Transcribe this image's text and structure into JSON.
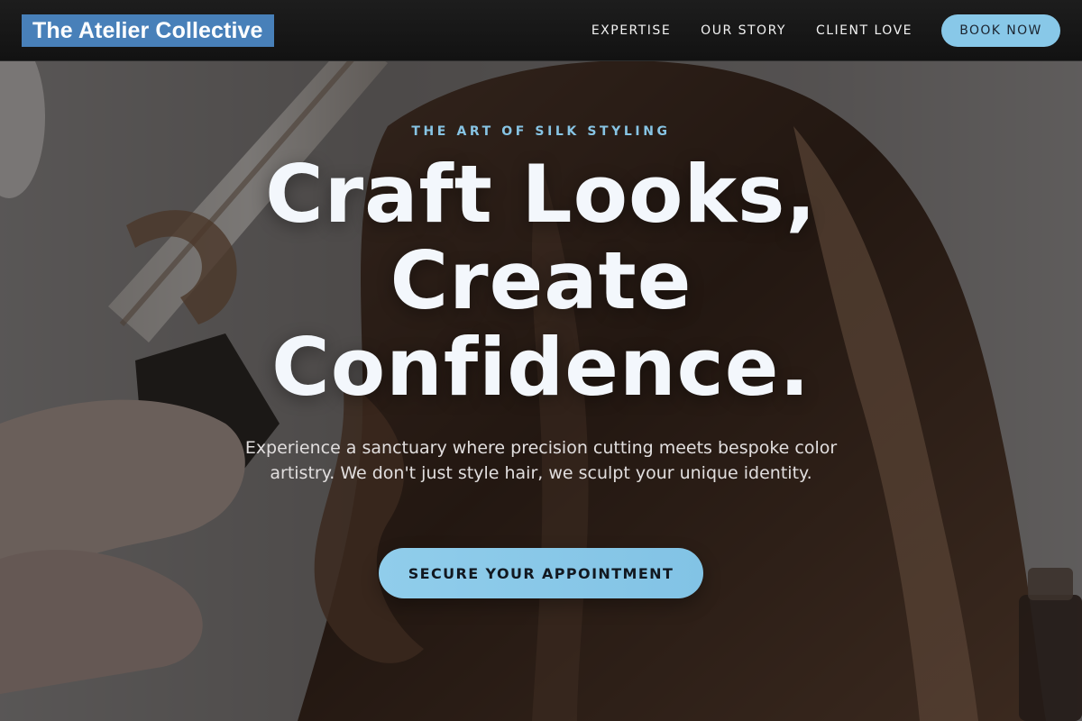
{
  "header": {
    "brand": "The Atelier Collective",
    "nav": [
      {
        "label": "EXPERTISE"
      },
      {
        "label": "OUR STORY"
      },
      {
        "label": "CLIENT LOVE"
      }
    ],
    "book_label": "BOOK NOW"
  },
  "hero": {
    "eyebrow": "THE ART OF SILK STYLING",
    "headline": "Craft Looks, Create Confidence.",
    "subtext": "Experience a sanctuary where precision cutting meets bespoke color artistry. We don't just style hair, we sculpt your unique identity.",
    "cta_label": "SECURE YOUR APPOINTMENT",
    "background_image": "hair-styling-photo"
  },
  "colors": {
    "brand_bg": "#4880b9",
    "accent": "#88c8e8",
    "eyebrow": "#87c4e4",
    "header_bg": "#161616"
  }
}
